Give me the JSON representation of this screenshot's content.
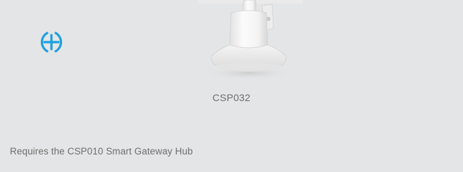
{
  "product": {
    "code": "CSP032",
    "requirement": "Requires the CSP010 Smart Gateway Hub",
    "image_icon": "ceiling-sensor-mount"
  },
  "add_button": {
    "icon": "plus-circle-icon",
    "color": "#1aa0e0"
  },
  "colors": {
    "background": "#e4e5e6",
    "text": "#6d6d6d",
    "accent": "#1aa0e0"
  }
}
